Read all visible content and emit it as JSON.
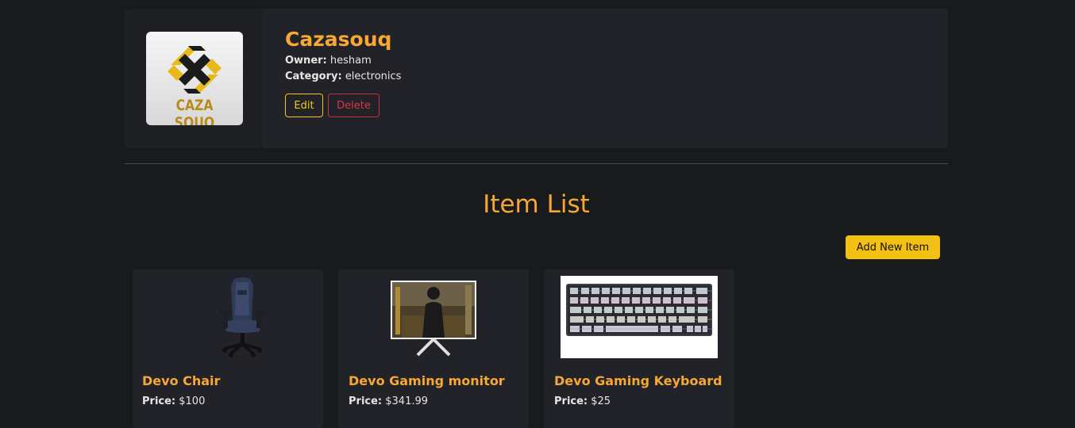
{
  "store": {
    "name": "Cazasouq",
    "logo_text": "CAZA SOUQ",
    "owner_label": "Owner:",
    "owner": "hesham",
    "category_label": "Category:",
    "category": "electronics",
    "edit_label": "Edit",
    "delete_label": "Delete"
  },
  "items_section": {
    "title": "Item List",
    "add_label": "Add New Item"
  },
  "items": [
    {
      "name": "Devo Chair",
      "price_label": "Price:",
      "price": "$100",
      "image": "gaming-chair"
    },
    {
      "name": "Devo Gaming monitor",
      "price_label": "Price:",
      "price": "$341.99",
      "image": "gaming-monitor"
    },
    {
      "name": "Devo Gaming Keyboard",
      "price_label": "Price:",
      "price": "$25",
      "image": "gaming-keyboard"
    }
  ],
  "colors": {
    "background": "#181a1b",
    "card": "#212328",
    "accent": "#f7a733",
    "add_button": "#f5c014",
    "edit": "#f5c518",
    "delete": "#dc3545"
  }
}
